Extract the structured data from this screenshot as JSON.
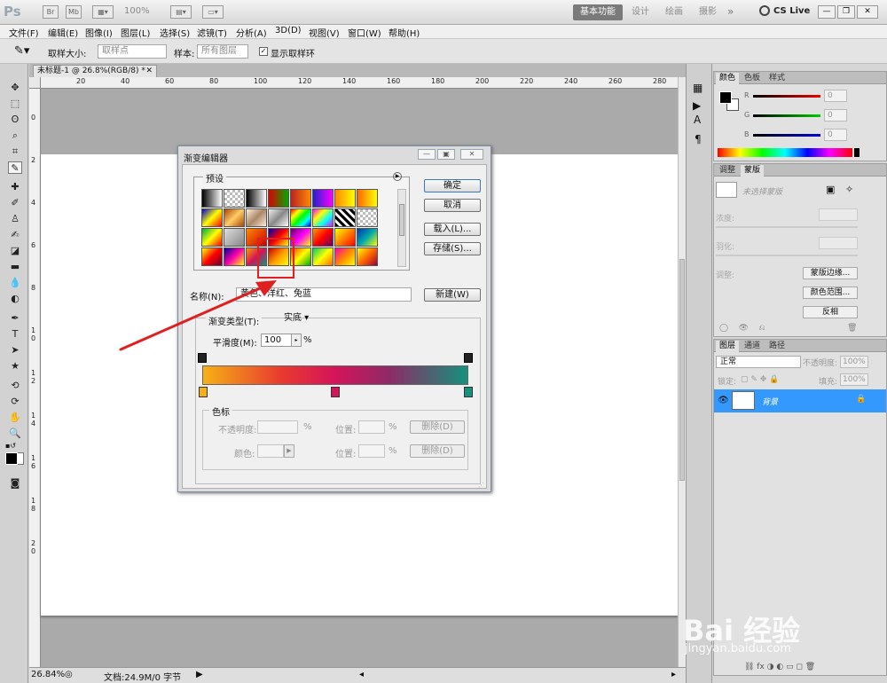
{
  "app": {
    "logo": "Ps",
    "zoom": "100%",
    "workspaces": [
      "基本功能",
      "设计",
      "绘画",
      "摄影"
    ],
    "cslive": "CS Live"
  },
  "menu": [
    "文件(F)",
    "编辑(E)",
    "图像(I)",
    "图层(L)",
    "选择(S)",
    "滤镜(T)",
    "分析(A)",
    "3D(D)",
    "视图(V)",
    "窗口(W)",
    "帮助(H)"
  ],
  "options": {
    "sample_size_label": "取样大小:",
    "sample_size_value": "取样点",
    "sample_label": "样本:",
    "sample_value": "所有图层",
    "show_ring_label": "显示取样环"
  },
  "document": {
    "tab": "未标题-1 @ 26.8%(RGB/8) *",
    "ruler_top": [
      "20",
      "40",
      "60",
      "80",
      "100",
      "120",
      "140",
      "160",
      "180",
      "200",
      "220",
      "240",
      "260",
      "280"
    ],
    "ruler_left": [
      "0",
      "2",
      "4",
      "6",
      "8",
      "1 0",
      "1 2",
      "1 4",
      "1 6",
      "1 8",
      "2 0"
    ],
    "zoom": "26.84%",
    "status": "文档:24.9M/0 字节"
  },
  "color_panel": {
    "tabs": [
      "颜色",
      "色板",
      "样式"
    ],
    "channels": [
      {
        "label": "R",
        "value": "0"
      },
      {
        "label": "G",
        "value": "0"
      },
      {
        "label": "B",
        "value": "0"
      }
    ]
  },
  "mask_panel": {
    "tabs": [
      "调整",
      "蒙版"
    ],
    "title": "未选择蒙版",
    "density_label": "浓度:",
    "feather_label": "羽化:",
    "adjust_label": "调整:",
    "buttons": [
      "蒙版边缘...",
      "颜色范围...",
      "反相"
    ]
  },
  "layers_panel": {
    "tabs": [
      "图层",
      "通道",
      "路径"
    ],
    "blend_mode": "正常",
    "opacity_label": "不透明度:",
    "opacity_value": "100%",
    "lock_label": "锁定:",
    "fill_label": "填充:",
    "fill_value": "100%",
    "layer_name": "背景"
  },
  "dialog": {
    "title": "渐变编辑器",
    "presets_label": "预设",
    "buttons": {
      "ok": "确定",
      "cancel": "取消",
      "load": "载入(L)...",
      "save": "存储(S)...",
      "new": "新建(W)"
    },
    "name_label": "名称(N):",
    "name_value": "黄色、洋红、兔蓝",
    "type_label": "渐变类型(T):",
    "type_value": "实底",
    "smooth_label": "平滑度(M):",
    "smooth_value": "100",
    "percent": "%",
    "stops_group": "色标",
    "opacity_label": "不透明度:",
    "location_label": "位置:",
    "color_label": "颜色:",
    "delete_label": "删除(D)"
  },
  "colors": {
    "accent": "#3399ff",
    "arrow": "#e02020",
    "gradient": [
      "#f6b016",
      "#d4145a",
      "#15917e"
    ]
  },
  "watermark": {
    "text": "Bai 经验",
    "url": "jingyan.baidu.com"
  }
}
